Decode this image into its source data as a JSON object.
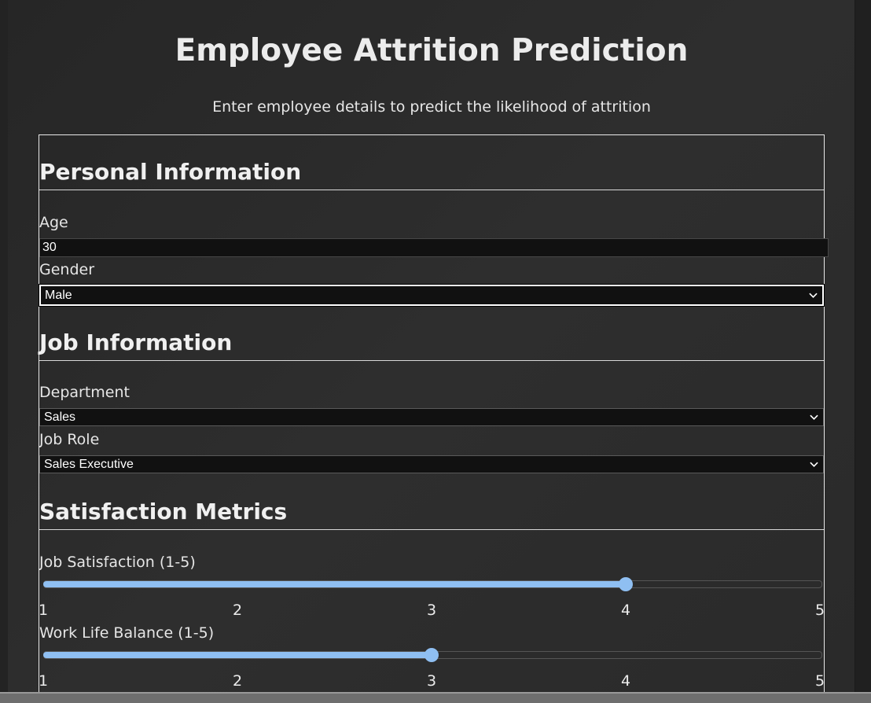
{
  "header": {
    "title": "Employee Attrition Prediction",
    "subtitle": "Enter employee details to predict the likelihood of attrition"
  },
  "personal": {
    "section_title": "Personal Information",
    "age_label": "Age",
    "age_value": "30",
    "gender_label": "Gender",
    "gender_value": "Male"
  },
  "job": {
    "section_title": "Job Information",
    "department_label": "Department",
    "department_value": "Sales",
    "role_label": "Job Role",
    "role_value": "Sales Executive"
  },
  "satisfaction": {
    "section_title": "Satisfaction Metrics",
    "job_satisfaction": {
      "label": "Job Satisfaction (1-5)",
      "value": 4,
      "min": 1,
      "max": 5,
      "ticks": [
        "1",
        "2",
        "3",
        "4",
        "5"
      ]
    },
    "work_life_balance": {
      "label": "Work Life Balance (1-5)",
      "value": 3,
      "min": 1,
      "max": 5,
      "ticks": [
        "1",
        "2",
        "3",
        "4",
        "5"
      ]
    }
  },
  "colors": {
    "slider_accent": "#8fbff2",
    "input_background": "#111111"
  }
}
